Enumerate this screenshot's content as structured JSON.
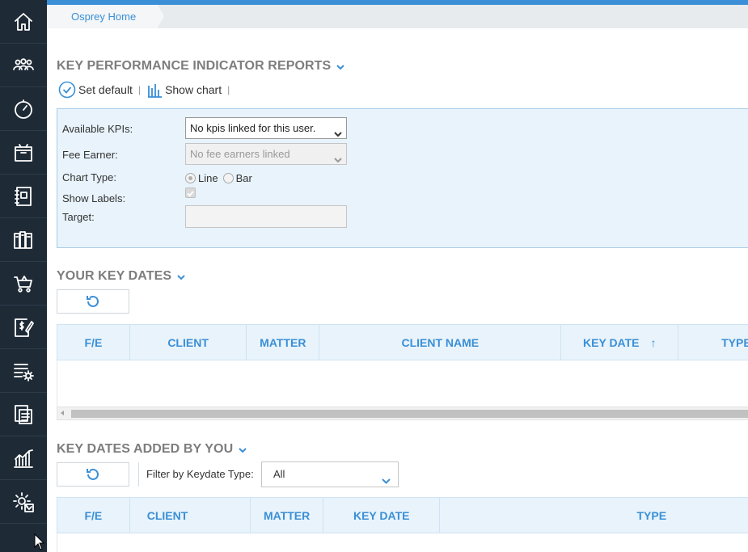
{
  "breadcrumb": {
    "home": "Osprey Home"
  },
  "sidebar": {
    "items": [
      {
        "name": "home-icon"
      },
      {
        "name": "people-icon"
      },
      {
        "name": "timer-icon"
      },
      {
        "name": "box-icon"
      },
      {
        "name": "notebook-icon"
      },
      {
        "name": "books-icon"
      },
      {
        "name": "cart-icon"
      },
      {
        "name": "billing-icon"
      },
      {
        "name": "settings-list-icon"
      },
      {
        "name": "documents-icon"
      },
      {
        "name": "analytics-icon"
      },
      {
        "name": "admin-gear-icon"
      }
    ]
  },
  "kpi": {
    "title": "KEY PERFORMANCE INDICATOR REPORTS",
    "set_default": "Set default",
    "show_chart": "Show chart",
    "separator": "|",
    "available_kpis_label": "Available KPIs:",
    "available_kpis_value": "No kpis linked for this user.",
    "fee_earner_label": "Fee Earner:",
    "fee_earner_value": "No fee earners linked",
    "chart_type_label": "Chart Type:",
    "chart_type_line": "Line",
    "chart_type_bar": "Bar",
    "show_labels_label": "Show Labels:",
    "target_label": "Target:"
  },
  "key_dates": {
    "title": "YOUR KEY DATES",
    "columns": [
      "F/E",
      "CLIENT",
      "MATTER",
      "CLIENT NAME",
      "KEY DATE",
      "TYPE"
    ],
    "sort_indicator": "↑"
  },
  "added_by_you": {
    "title": "KEY DATES ADDED BY YOU",
    "filter_label": "Filter by Keydate Type:",
    "filter_value": "All",
    "columns": [
      "F/E",
      "CLIENT",
      "MATTER",
      "KEY DATE",
      "TYPE"
    ]
  },
  "colors": {
    "accent": "#3a8fd6",
    "sidebar": "#1e2a36",
    "panel": "#e8f3fb"
  }
}
